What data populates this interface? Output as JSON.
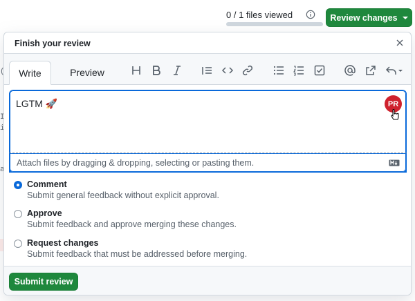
{
  "top": {
    "files_viewed": "0 / 1 files viewed",
    "files_viewed_progress": 0,
    "review_button": "Review changes"
  },
  "panel": {
    "title": "Finish your review",
    "tabs": [
      "Write",
      "Preview"
    ],
    "toolbar_icons": [
      "heading-icon",
      "bold-icon",
      "italic-icon",
      "quote-icon",
      "code-icon",
      "link-icon",
      "bullet-list-icon",
      "numbered-list-icon",
      "task-list-icon",
      "mention-icon",
      "reference-icon",
      "undo-icon"
    ],
    "editor_text": "LGTM 🚀",
    "avatar_initials": "PR",
    "attach_text": "Attach files by dragging & dropping, selecting or pasting them.",
    "options": [
      {
        "title": "Comment",
        "desc": "Submit general feedback without explicit approval.",
        "checked": true
      },
      {
        "title": "Approve",
        "desc": "Submit feedback and approve merging these changes.",
        "checked": false
      },
      {
        "title": "Request changes",
        "desc": "Submit feedback that must be addressed before merging.",
        "checked": false
      }
    ],
    "submit_button": "Submit review"
  },
  "colors": {
    "primary": "#1f883d",
    "accent": "#0969da",
    "avatar": "#cf222e"
  }
}
